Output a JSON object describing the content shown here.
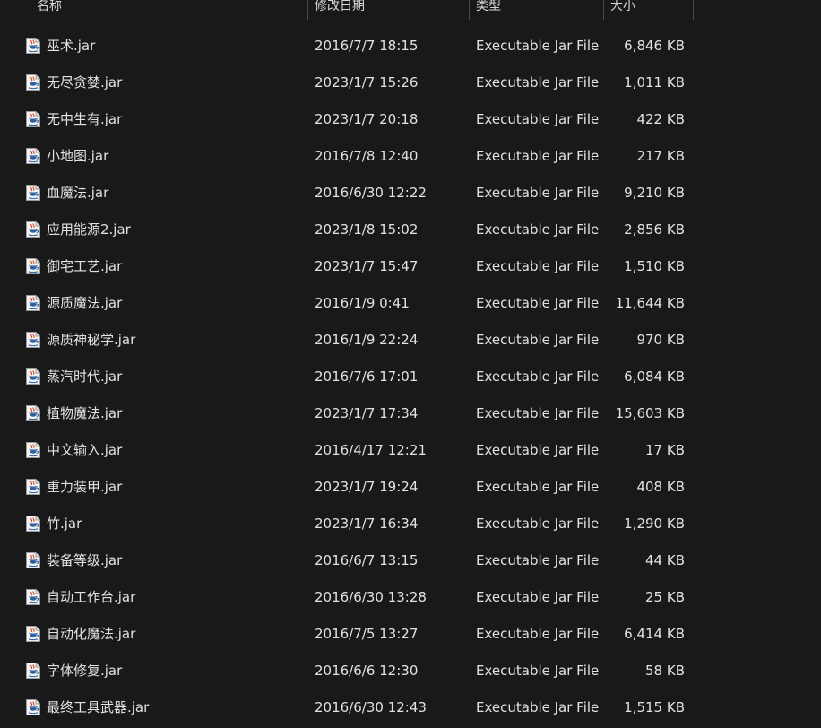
{
  "columns": {
    "name": "名称",
    "modified": "修改日期",
    "type": "类型",
    "size": "大小"
  },
  "icon": "java-jar-file-icon",
  "files": [
    {
      "name": "巫术.jar",
      "modified": "2016/7/7 18:15",
      "type": "Executable Jar File",
      "size": "6,846 KB"
    },
    {
      "name": "无尽贪婪.jar",
      "modified": "2023/1/7 15:26",
      "type": "Executable Jar File",
      "size": "1,011 KB"
    },
    {
      "name": "无中生有.jar",
      "modified": "2023/1/7 20:18",
      "type": "Executable Jar File",
      "size": "422 KB"
    },
    {
      "name": "小地图.jar",
      "modified": "2016/7/8 12:40",
      "type": "Executable Jar File",
      "size": "217 KB"
    },
    {
      "name": "血魔法.jar",
      "modified": "2016/6/30 12:22",
      "type": "Executable Jar File",
      "size": "9,210 KB"
    },
    {
      "name": "应用能源2.jar",
      "modified": "2023/1/8 15:02",
      "type": "Executable Jar File",
      "size": "2,856 KB"
    },
    {
      "name": "御宅工艺.jar",
      "modified": "2023/1/7 15:47",
      "type": "Executable Jar File",
      "size": "1,510 KB"
    },
    {
      "name": "源质魔法.jar",
      "modified": "2016/1/9 0:41",
      "type": "Executable Jar File",
      "size": "11,644 KB"
    },
    {
      "name": "源质神秘学.jar",
      "modified": "2016/1/9 22:24",
      "type": "Executable Jar File",
      "size": "970 KB"
    },
    {
      "name": "蒸汽时代.jar",
      "modified": "2016/7/6 17:01",
      "type": "Executable Jar File",
      "size": "6,084 KB"
    },
    {
      "name": "植物魔法.jar",
      "modified": "2023/1/7 17:34",
      "type": "Executable Jar File",
      "size": "15,603 KB"
    },
    {
      "name": "中文输入.jar",
      "modified": "2016/4/17 12:21",
      "type": "Executable Jar File",
      "size": "17 KB"
    },
    {
      "name": "重力装甲.jar",
      "modified": "2023/1/7 19:24",
      "type": "Executable Jar File",
      "size": "408 KB"
    },
    {
      "name": "竹.jar",
      "modified": "2023/1/7 16:34",
      "type": "Executable Jar File",
      "size": "1,290 KB"
    },
    {
      "name": "装备等级.jar",
      "modified": "2016/6/7 13:15",
      "type": "Executable Jar File",
      "size": "44 KB"
    },
    {
      "name": "自动工作台.jar",
      "modified": "2016/6/30 13:28",
      "type": "Executable Jar File",
      "size": "25 KB"
    },
    {
      "name": "自动化魔法.jar",
      "modified": "2016/7/5 13:27",
      "type": "Executable Jar File",
      "size": "6,414 KB"
    },
    {
      "name": "字体修复.jar",
      "modified": "2016/6/6 12:30",
      "type": "Executable Jar File",
      "size": "58 KB"
    },
    {
      "name": "最终工具武器.jar",
      "modified": "2016/6/30 12:43",
      "type": "Executable Jar File",
      "size": "1,515 KB"
    }
  ]
}
